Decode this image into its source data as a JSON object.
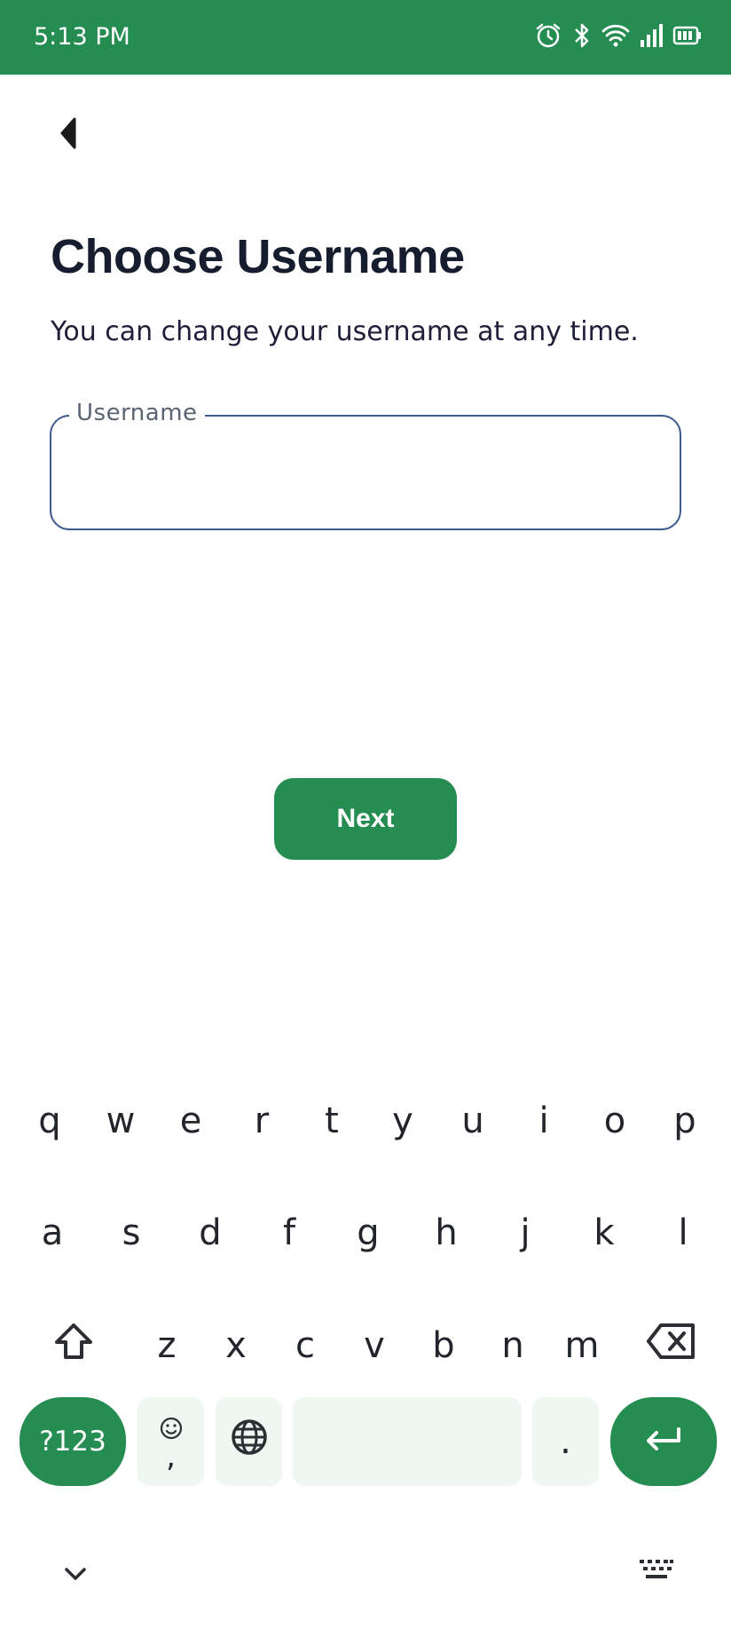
{
  "status_bar": {
    "time": "5:13 PM",
    "icons": [
      "alarm-icon",
      "bluetooth-icon",
      "wifi-icon",
      "signal-icon",
      "battery-icon"
    ],
    "background": "#258c52"
  },
  "header": {
    "back_icon": "back-arrow-icon"
  },
  "main": {
    "title": "Choose Username",
    "subtitle": "You can change your username at any time.",
    "username_field": {
      "label": "Username",
      "value": ""
    },
    "next_button": "Next"
  },
  "keyboard": {
    "row1": [
      "q",
      "w",
      "e",
      "r",
      "t",
      "y",
      "u",
      "i",
      "o",
      "p"
    ],
    "row2": [
      "a",
      "s",
      "d",
      "f",
      "g",
      "h",
      "j",
      "k",
      "l"
    ],
    "row3": [
      "z",
      "x",
      "c",
      "v",
      "b",
      "n",
      "m"
    ],
    "symbols_key": "?123",
    "comma_key": ",",
    "period_key": ".",
    "accent": "#258c52",
    "key_background": "#eef8f0"
  }
}
